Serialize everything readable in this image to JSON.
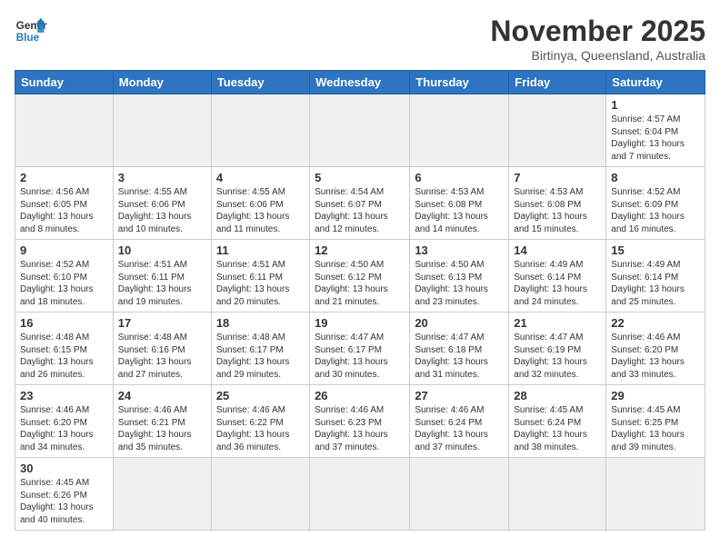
{
  "logo": {
    "line1": "General",
    "line2": "Blue"
  },
  "title": "November 2025",
  "location": "Birtinya, Queensland, Australia",
  "days_of_week": [
    "Sunday",
    "Monday",
    "Tuesday",
    "Wednesday",
    "Thursday",
    "Friday",
    "Saturday"
  ],
  "weeks": [
    [
      {
        "day": "",
        "info": "",
        "empty": true
      },
      {
        "day": "",
        "info": "",
        "empty": true
      },
      {
        "day": "",
        "info": "",
        "empty": true
      },
      {
        "day": "",
        "info": "",
        "empty": true
      },
      {
        "day": "",
        "info": "",
        "empty": true
      },
      {
        "day": "",
        "info": "",
        "empty": true
      },
      {
        "day": "1",
        "info": "Sunrise: 4:57 AM\nSunset: 6:04 PM\nDaylight: 13 hours and 7 minutes."
      }
    ],
    [
      {
        "day": "2",
        "info": "Sunrise: 4:56 AM\nSunset: 6:05 PM\nDaylight: 13 hours and 8 minutes."
      },
      {
        "day": "3",
        "info": "Sunrise: 4:55 AM\nSunset: 6:06 PM\nDaylight: 13 hours and 10 minutes."
      },
      {
        "day": "4",
        "info": "Sunrise: 4:55 AM\nSunset: 6:06 PM\nDaylight: 13 hours and 11 minutes."
      },
      {
        "day": "5",
        "info": "Sunrise: 4:54 AM\nSunset: 6:07 PM\nDaylight: 13 hours and 12 minutes."
      },
      {
        "day": "6",
        "info": "Sunrise: 4:53 AM\nSunset: 6:08 PM\nDaylight: 13 hours and 14 minutes."
      },
      {
        "day": "7",
        "info": "Sunrise: 4:53 AM\nSunset: 6:08 PM\nDaylight: 13 hours and 15 minutes."
      },
      {
        "day": "8",
        "info": "Sunrise: 4:52 AM\nSunset: 6:09 PM\nDaylight: 13 hours and 16 minutes."
      }
    ],
    [
      {
        "day": "9",
        "info": "Sunrise: 4:52 AM\nSunset: 6:10 PM\nDaylight: 13 hours and 18 minutes."
      },
      {
        "day": "10",
        "info": "Sunrise: 4:51 AM\nSunset: 6:11 PM\nDaylight: 13 hours and 19 minutes."
      },
      {
        "day": "11",
        "info": "Sunrise: 4:51 AM\nSunset: 6:11 PM\nDaylight: 13 hours and 20 minutes."
      },
      {
        "day": "12",
        "info": "Sunrise: 4:50 AM\nSunset: 6:12 PM\nDaylight: 13 hours and 21 minutes."
      },
      {
        "day": "13",
        "info": "Sunrise: 4:50 AM\nSunset: 6:13 PM\nDaylight: 13 hours and 23 minutes."
      },
      {
        "day": "14",
        "info": "Sunrise: 4:49 AM\nSunset: 6:14 PM\nDaylight: 13 hours and 24 minutes."
      },
      {
        "day": "15",
        "info": "Sunrise: 4:49 AM\nSunset: 6:14 PM\nDaylight: 13 hours and 25 minutes."
      }
    ],
    [
      {
        "day": "16",
        "info": "Sunrise: 4:48 AM\nSunset: 6:15 PM\nDaylight: 13 hours and 26 minutes."
      },
      {
        "day": "17",
        "info": "Sunrise: 4:48 AM\nSunset: 6:16 PM\nDaylight: 13 hours and 27 minutes."
      },
      {
        "day": "18",
        "info": "Sunrise: 4:48 AM\nSunset: 6:17 PM\nDaylight: 13 hours and 29 minutes."
      },
      {
        "day": "19",
        "info": "Sunrise: 4:47 AM\nSunset: 6:17 PM\nDaylight: 13 hours and 30 minutes."
      },
      {
        "day": "20",
        "info": "Sunrise: 4:47 AM\nSunset: 6:18 PM\nDaylight: 13 hours and 31 minutes."
      },
      {
        "day": "21",
        "info": "Sunrise: 4:47 AM\nSunset: 6:19 PM\nDaylight: 13 hours and 32 minutes."
      },
      {
        "day": "22",
        "info": "Sunrise: 4:46 AM\nSunset: 6:20 PM\nDaylight: 13 hours and 33 minutes."
      }
    ],
    [
      {
        "day": "23",
        "info": "Sunrise: 4:46 AM\nSunset: 6:20 PM\nDaylight: 13 hours and 34 minutes."
      },
      {
        "day": "24",
        "info": "Sunrise: 4:46 AM\nSunset: 6:21 PM\nDaylight: 13 hours and 35 minutes."
      },
      {
        "day": "25",
        "info": "Sunrise: 4:46 AM\nSunset: 6:22 PM\nDaylight: 13 hours and 36 minutes."
      },
      {
        "day": "26",
        "info": "Sunrise: 4:46 AM\nSunset: 6:23 PM\nDaylight: 13 hours and 37 minutes."
      },
      {
        "day": "27",
        "info": "Sunrise: 4:46 AM\nSunset: 6:24 PM\nDaylight: 13 hours and 37 minutes."
      },
      {
        "day": "28",
        "info": "Sunrise: 4:45 AM\nSunset: 6:24 PM\nDaylight: 13 hours and 38 minutes."
      },
      {
        "day": "29",
        "info": "Sunrise: 4:45 AM\nSunset: 6:25 PM\nDaylight: 13 hours and 39 minutes."
      }
    ],
    [
      {
        "day": "30",
        "info": "Sunrise: 4:45 AM\nSunset: 6:26 PM\nDaylight: 13 hours and 40 minutes."
      },
      {
        "day": "",
        "info": "",
        "empty": true
      },
      {
        "day": "",
        "info": "",
        "empty": true
      },
      {
        "day": "",
        "info": "",
        "empty": true
      },
      {
        "day": "",
        "info": "",
        "empty": true
      },
      {
        "day": "",
        "info": "",
        "empty": true
      },
      {
        "day": "",
        "info": "",
        "empty": true
      }
    ]
  ]
}
